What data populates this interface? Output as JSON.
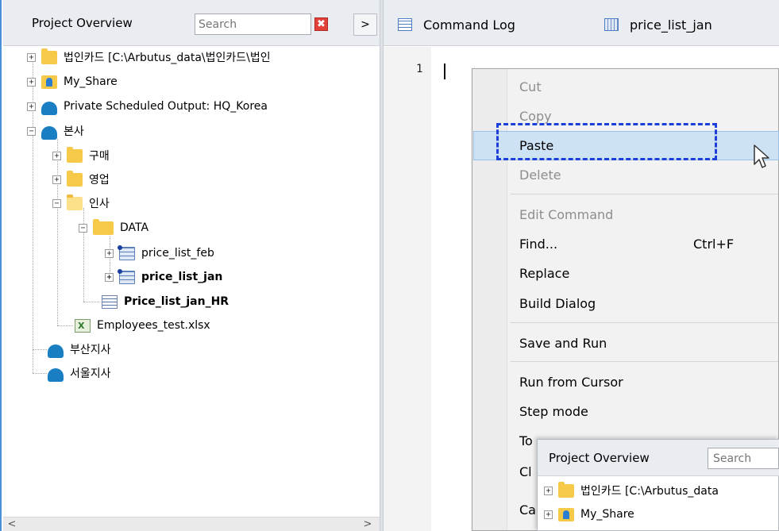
{
  "project_panel": {
    "title": "Project Overview",
    "search_placeholder": "Search",
    "clear_symbol": "✖",
    "expand_symbol": ">",
    "tree": [
      {
        "label": "법인카드 [C:\\Arbutus_data\\법인카드\\법인",
        "icon": "folder-icon",
        "toggle": "+"
      },
      {
        "label": "My_Share",
        "icon": "shared-folder-icon",
        "toggle": "+"
      },
      {
        "label": "Private Scheduled Output:  HQ_Korea",
        "icon": "cloud-icon",
        "toggle": "+"
      },
      {
        "label": "본사",
        "icon": "cloud-icon",
        "toggle": "−"
      },
      {
        "label": "구매",
        "icon": "folder-icon",
        "toggle": "+"
      },
      {
        "label": "영업",
        "icon": "folder-icon",
        "toggle": "+"
      },
      {
        "label": "인사",
        "icon": "open-folder-icon",
        "toggle": "−"
      },
      {
        "label": "DATA",
        "icon": "folder-icon",
        "toggle": "−"
      },
      {
        "label": "price_list_feb",
        "icon": "table-icon",
        "toggle": "+"
      },
      {
        "label": "price_list_jan",
        "icon": "table-icon",
        "toggle": "+",
        "bold": true
      },
      {
        "label": "Price_list_jan_HR",
        "icon": "script-icon",
        "bold": true
      },
      {
        "label": "Employees_test.xlsx",
        "icon": "excel-file-icon"
      },
      {
        "label": "부산지사",
        "icon": "cloud-icon"
      },
      {
        "label": "서울지사",
        "icon": "cloud-icon"
      }
    ],
    "scroll_left": "<",
    "scroll_right": ">"
  },
  "tabs": [
    {
      "label": "Command Log",
      "icon": "command-log-icon"
    },
    {
      "label": "price_list_jan",
      "icon": "table-view-icon"
    }
  ],
  "editor": {
    "line_number": "1"
  },
  "context_menu": {
    "items": [
      {
        "label": "Cut",
        "disabled": true
      },
      {
        "label": "Copy",
        "disabled": true
      },
      {
        "label": "Paste",
        "highlighted": true
      },
      {
        "label": "Delete",
        "disabled": true
      },
      {
        "label": "Edit Command",
        "disabled": true
      },
      {
        "label": "Find...",
        "shortcut": "Ctrl+F"
      },
      {
        "label": "Replace"
      },
      {
        "label": "Build Dialog"
      },
      {
        "label": "Save and Run"
      },
      {
        "label": "Run from Cursor"
      },
      {
        "label": "Step mode"
      },
      {
        "label": "To"
      },
      {
        "label": "Cl"
      },
      {
        "label": "Ca"
      }
    ]
  },
  "inset": {
    "title": "Project Overview",
    "search_placeholder": "Search",
    "tree": [
      {
        "label": "법인카드 [C:\\Arbutus_data",
        "icon": "folder-icon",
        "toggle": "+"
      },
      {
        "label": "My_Share",
        "icon": "shared-folder-icon",
        "toggle": "+"
      }
    ]
  },
  "colors": {
    "highlight_box": "#1d3fd9",
    "menu_highlight": "#cde2f5",
    "accent": "#4a90d9"
  }
}
